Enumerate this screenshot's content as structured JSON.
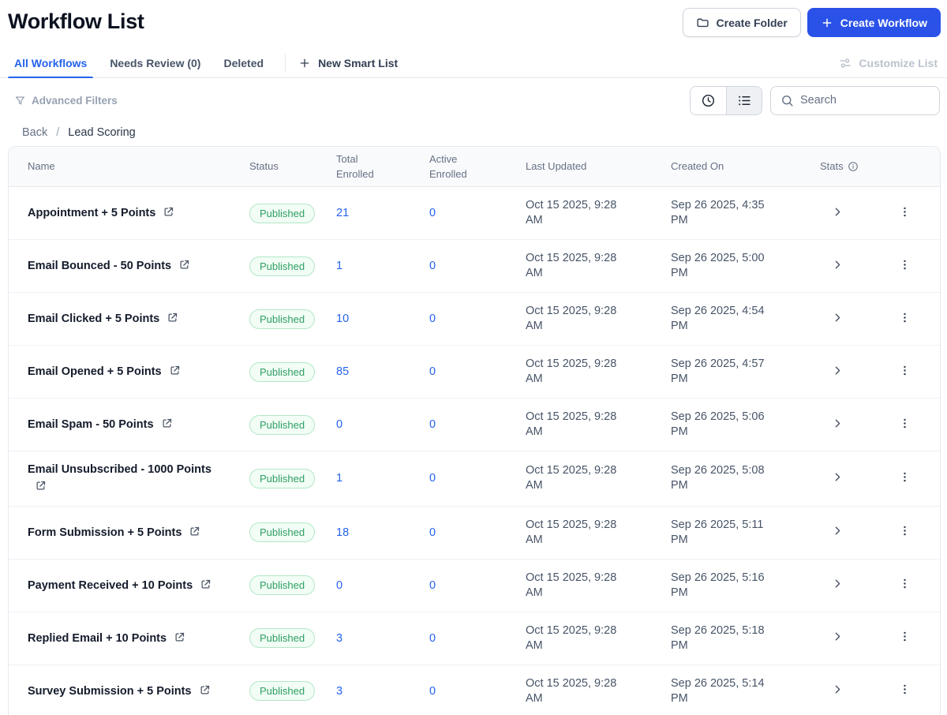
{
  "page": {
    "title": "Workflow List"
  },
  "header_actions": {
    "create_folder": "Create Folder",
    "create_workflow": "Create Workflow"
  },
  "tabs": {
    "items": [
      {
        "label": "All Workflows",
        "active": true
      },
      {
        "label": "Needs Review (0)",
        "active": false
      },
      {
        "label": "Deleted",
        "active": false
      }
    ],
    "new_smart_list": "New Smart List",
    "customize_list": "Customize List"
  },
  "filters": {
    "advanced_filters_label": "Advanced Filters",
    "search_placeholder": "Search"
  },
  "breadcrumb": {
    "back": "Back",
    "separator": "/",
    "current": "Lead Scoring"
  },
  "table": {
    "columns": {
      "name": "Name",
      "status": "Status",
      "total_enrolled": "Total Enrolled",
      "active_enrolled": "Active Enrolled",
      "last_updated": "Last Updated",
      "created_on": "Created On",
      "stats": "Stats"
    },
    "rows": [
      {
        "name": "Appointment + 5 Points",
        "status": "Published",
        "total_enrolled": "21",
        "active_enrolled": "0",
        "last_updated": "Oct 15 2025, 9:28 AM",
        "created_on": "Sep 26 2025, 4:35 PM"
      },
      {
        "name": "Email Bounced - 50 Points",
        "status": "Published",
        "total_enrolled": "1",
        "active_enrolled": "0",
        "last_updated": "Oct 15 2025, 9:28 AM",
        "created_on": "Sep 26 2025, 5:00 PM"
      },
      {
        "name": "Email Clicked + 5 Points",
        "status": "Published",
        "total_enrolled": "10",
        "active_enrolled": "0",
        "last_updated": "Oct 15 2025, 9:28 AM",
        "created_on": "Sep 26 2025, 4:54 PM"
      },
      {
        "name": "Email Opened + 5 Points",
        "status": "Published",
        "total_enrolled": "85",
        "active_enrolled": "0",
        "last_updated": "Oct 15 2025, 9:28 AM",
        "created_on": "Sep 26 2025, 4:57 PM"
      },
      {
        "name": "Email Spam - 50 Points",
        "status": "Published",
        "total_enrolled": "0",
        "active_enrolled": "0",
        "last_updated": "Oct 15 2025, 9:28 AM",
        "created_on": "Sep 26 2025, 5:06 PM"
      },
      {
        "name": "Email Unsubscribed - 1000 Points",
        "status": "Published",
        "total_enrolled": "1",
        "active_enrolled": "0",
        "last_updated": "Oct 15 2025, 9:28 AM",
        "created_on": "Sep 26 2025, 5:08 PM"
      },
      {
        "name": "Form Submission + 5 Points",
        "status": "Published",
        "total_enrolled": "18",
        "active_enrolled": "0",
        "last_updated": "Oct 15 2025, 9:28 AM",
        "created_on": "Sep 26 2025, 5:11 PM"
      },
      {
        "name": "Payment Received + 10 Points",
        "status": "Published",
        "total_enrolled": "0",
        "active_enrolled": "0",
        "last_updated": "Oct 15 2025, 9:28 AM",
        "created_on": "Sep 26 2025, 5:16 PM"
      },
      {
        "name": "Replied Email + 10 Points",
        "status": "Published",
        "total_enrolled": "3",
        "active_enrolled": "0",
        "last_updated": "Oct 15 2025, 9:28 AM",
        "created_on": "Sep 26 2025, 5:18 PM"
      },
      {
        "name": "Survey Submission + 5 Points",
        "status": "Published",
        "total_enrolled": "3",
        "active_enrolled": "0",
        "last_updated": "Oct 15 2025, 9:28 AM",
        "created_on": "Sep 26 2025, 5:14 PM"
      }
    ]
  },
  "colors": {
    "primary_blue": "#2a52e8",
    "link_blue": "#2563eb",
    "badge_green_text": "#2f9e63",
    "badge_green_bg": "#f1fdf5",
    "badge_green_border": "#b4e7c8",
    "header_gray": "#667085",
    "border_gray": "#e7e9f0"
  }
}
